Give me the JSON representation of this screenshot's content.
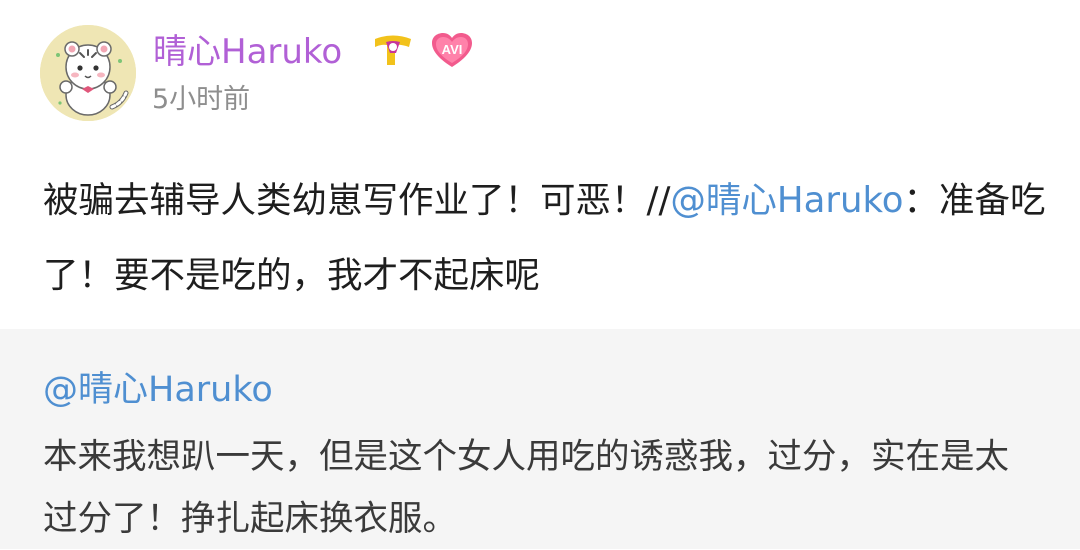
{
  "post": {
    "username": "晴心Haruko",
    "time": "5小时前",
    "badges": {
      "vip": "vip-badge-icon",
      "avi": "AVI"
    },
    "body": {
      "text": "被骗去辅导人类幼崽写作业了！可恶！//",
      "mention": "@晴心Haruko",
      "mention_suffix": "：准备吃了！要不是吃的，我才不起床呢"
    }
  },
  "retweet": {
    "author": "@晴心Haruko",
    "body": "本来我想趴一天，但是这个女人用吃的诱惑我，过分，实在是太过分了！挣扎起床换衣服。"
  },
  "colors": {
    "username": "#b160d6",
    "link": "#4f8fd1",
    "time": "#8e8e8e",
    "retweet_bg": "#f5f5f5"
  }
}
